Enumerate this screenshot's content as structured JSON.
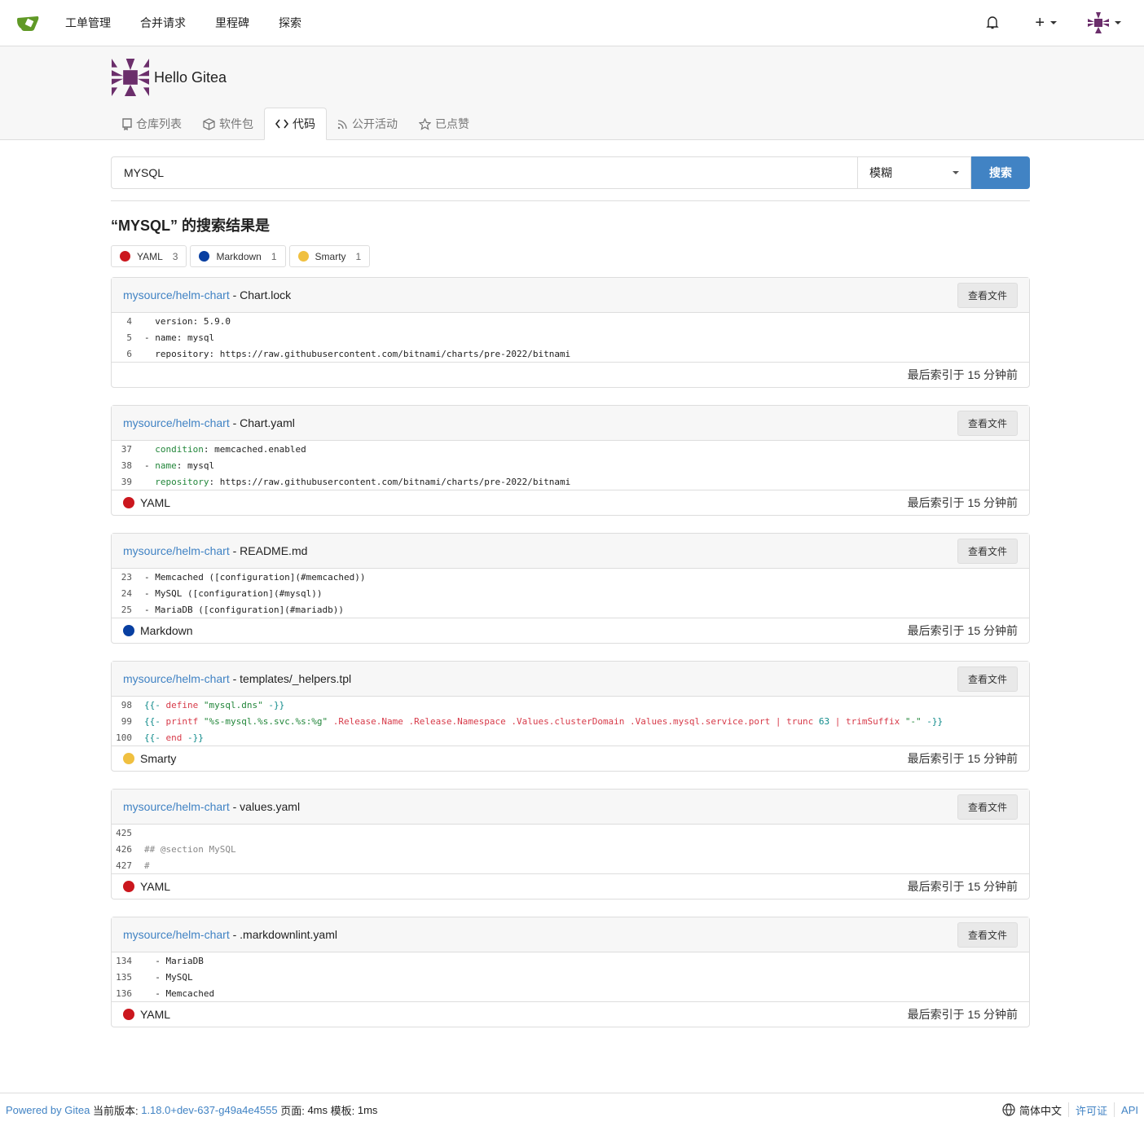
{
  "nav": {
    "items": [
      "工单管理",
      "合并请求",
      "里程碑",
      "探索"
    ],
    "brand_color": "#609926"
  },
  "org": {
    "name": "Hello Gitea",
    "avatar_color": "#6b2e6b"
  },
  "tabs": [
    {
      "label": "仓库列表",
      "icon": "repo-icon"
    },
    {
      "label": "软件包",
      "icon": "package-icon"
    },
    {
      "label": "代码",
      "icon": "code-icon",
      "active": true
    },
    {
      "label": "公开活动",
      "icon": "rss-icon"
    },
    {
      "label": "已点赞",
      "icon": "star-icon"
    }
  ],
  "search": {
    "value": "MYSQL",
    "mode": "模糊",
    "button": "搜索"
  },
  "results_title": "“MYSQL” 的搜索结果是",
  "languages": [
    {
      "name": "YAML",
      "count": "3",
      "color": "#cb171e"
    },
    {
      "name": "Markdown",
      "count": "1",
      "color": "#083fa1"
    },
    {
      "name": "Smarty",
      "count": "1",
      "color": "#f0c040"
    }
  ],
  "view_label": "查看文件",
  "results": [
    {
      "repo": "mysource/helm-chart",
      "file": "Chart.lock",
      "lang": "",
      "lang_color": "",
      "indexed": "最后索引于 15 分钟前",
      "lines": [
        {
          "n": "4",
          "tokens": [
            {
              "t": "  version: 5.9.0"
            }
          ]
        },
        {
          "n": "5",
          "tokens": [
            {
              "t": "- name: mysql"
            }
          ]
        },
        {
          "n": "6",
          "tokens": [
            {
              "t": "  repository: https://raw.githubusercontent.com/bitnami/charts/pre-2022/bitnami"
            }
          ]
        }
      ]
    },
    {
      "repo": "mysource/helm-chart",
      "file": "Chart.yaml",
      "lang": "YAML",
      "lang_color": "#cb171e",
      "indexed": "最后索引于 15 分钟前",
      "lines": [
        {
          "n": "37",
          "tokens": [
            {
              "t": "  "
            },
            {
              "t": "condition",
              "c": "g"
            },
            {
              "t": ": memcached.enabled"
            }
          ]
        },
        {
          "n": "38",
          "tokens": [
            {
              "t": "- "
            },
            {
              "t": "name",
              "c": "g"
            },
            {
              "t": ": mysql"
            }
          ]
        },
        {
          "n": "39",
          "tokens": [
            {
              "t": "  "
            },
            {
              "t": "repository",
              "c": "g"
            },
            {
              "t": ": https://raw.githubusercontent.com/bitnami/charts/pre-2022/bitnami"
            }
          ]
        }
      ]
    },
    {
      "repo": "mysource/helm-chart",
      "file": "README.md",
      "lang": "Markdown",
      "lang_color": "#083fa1",
      "indexed": "最后索引于 15 分钟前",
      "lines": [
        {
          "n": "23",
          "tokens": [
            {
              "t": "- Memcached ([configuration](#memcached))"
            }
          ]
        },
        {
          "n": "24",
          "tokens": [
            {
              "t": "- MySQL ([configuration](#mysql))"
            }
          ]
        },
        {
          "n": "25",
          "tokens": [
            {
              "t": "- MariaDB ([configuration](#mariadb))"
            }
          ]
        }
      ]
    },
    {
      "repo": "mysource/helm-chart",
      "file": "templates/_helpers.tpl",
      "lang": "Smarty",
      "lang_color": "#f0c040",
      "indexed": "最后索引于 15 分钟前",
      "lines": [
        {
          "n": "98",
          "tokens": [
            {
              "t": "{{-",
              "c": "p"
            },
            {
              "t": " define ",
              "c": "k"
            },
            {
              "t": "\"mysql.dns\"",
              "c": "s"
            },
            {
              "t": " -}}",
              "c": "p"
            }
          ]
        },
        {
          "n": "99",
          "tokens": [
            {
              "t": "{{-",
              "c": "p"
            },
            {
              "t": " printf ",
              "c": "k"
            },
            {
              "t": "\"%s-mysql.%s.svc.%s:%g\"",
              "c": "s"
            },
            {
              "t": " .Release.Name .Release.Namespace .Values.clusterDomain .Values.mysql.service.port | trunc ",
              "c": "k"
            },
            {
              "t": "63",
              "c": "p"
            },
            {
              "t": " | trimSuffix ",
              "c": "k"
            },
            {
              "t": "\"-\"",
              "c": "s"
            },
            {
              "t": " -}}",
              "c": "p"
            }
          ]
        },
        {
          "n": "100",
          "tokens": [
            {
              "t": "{{-",
              "c": "p"
            },
            {
              "t": " end ",
              "c": "k"
            },
            {
              "t": "-}}",
              "c": "p"
            }
          ]
        }
      ]
    },
    {
      "repo": "mysource/helm-chart",
      "file": "values.yaml",
      "lang": "YAML",
      "lang_color": "#cb171e",
      "indexed": "最后索引于 15 分钟前",
      "lines": [
        {
          "n": "425",
          "tokens": [
            {
              "t": ""
            }
          ]
        },
        {
          "n": "426",
          "tokens": [
            {
              "t": "## @section MySQL",
              "c": "c"
            }
          ]
        },
        {
          "n": "427",
          "tokens": [
            {
              "t": "#",
              "c": "c"
            }
          ]
        }
      ]
    },
    {
      "repo": "mysource/helm-chart",
      "file": ".markdownlint.yaml",
      "lang": "YAML",
      "lang_color": "#cb171e",
      "indexed": "最后索引于 15 分钟前",
      "lines": [
        {
          "n": "134",
          "tokens": [
            {
              "t": "  - MariaDB"
            }
          ]
        },
        {
          "n": "135",
          "tokens": [
            {
              "t": "  - MySQL"
            }
          ]
        },
        {
          "n": "136",
          "tokens": [
            {
              "t": "  - Memcached"
            }
          ]
        }
      ]
    }
  ],
  "footer": {
    "powered": "Powered by Gitea",
    "version_label": "当前版本:",
    "version": "1.18.0+dev-637-g49a4e4555",
    "page_label": "页面:",
    "page_time": "4ms",
    "tmpl_label": "模板:",
    "tmpl_time": "1ms",
    "language": "简体中文",
    "license": "许可证",
    "api": "API"
  }
}
